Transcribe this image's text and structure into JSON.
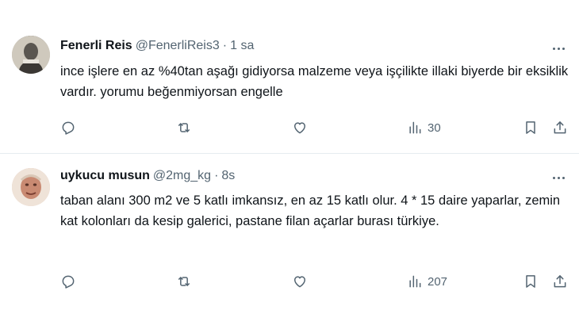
{
  "tweets": [
    {
      "name": "Fenerli Reis",
      "handle": "@FenerliReis3",
      "separator": "·",
      "time": "1 sa",
      "text": "ince işlere en az %40tan aşağı gidiyorsa malzeme veya işçilikte illaki biyerde bir eksiklik vardır. yorumu beğenmiyorsan engelle",
      "views": "30"
    },
    {
      "name": "uykucu musun",
      "handle": "@2mg_kg",
      "separator": "·",
      "time": "8s",
      "text": "taban alanı 300 m2 ve 5 katlı imkansız, en az 15 katlı olur. 4 * 15 daire yaparlar, zemin kat kolonları da kesip galerici, pastane filan açarlar burası türkiye.",
      "views": "207"
    }
  ],
  "icons": {
    "reply": "reply-icon",
    "retweet": "retweet-icon",
    "like": "heart-icon",
    "views": "views-chart-icon",
    "bookmark": "bookmark-icon",
    "share": "share-icon",
    "more": "more-dots-icon"
  },
  "colors": {
    "text_primary": "#0f1419",
    "text_secondary": "#536471",
    "divider": "#e6ecf0"
  }
}
